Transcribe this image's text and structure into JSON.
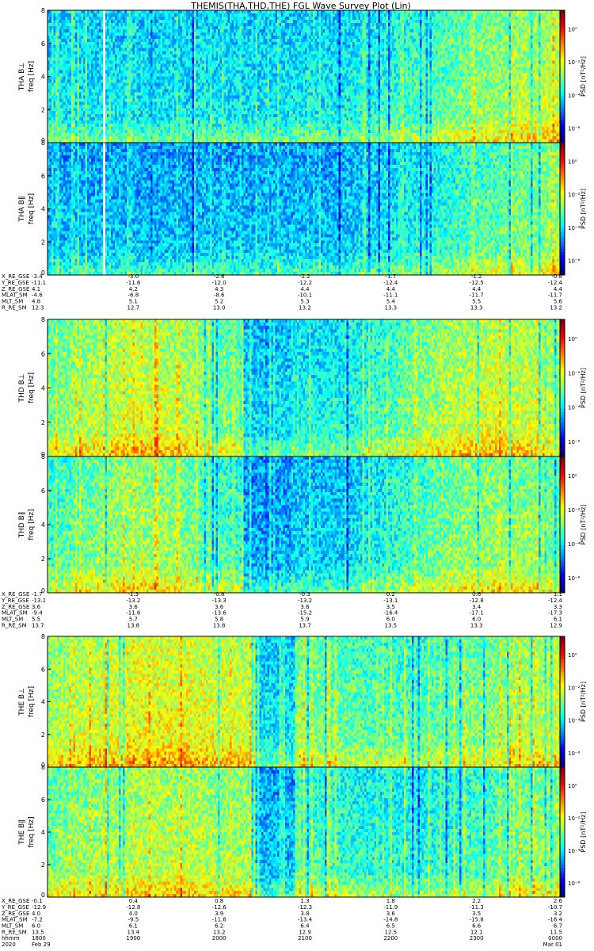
{
  "title": "THEMIS(THA,THD,THE) FGL Wave Survey Plot (Lin)",
  "chart_data": {
    "type": "heatmap",
    "x_axis": {
      "label": "hhmm",
      "date_label": "2020",
      "tick_labels": [
        "Feb 29",
        "1800",
        "1900",
        "2000",
        "2100",
        "2200",
        "2300",
        "0000",
        "Mar 01"
      ]
    },
    "colorbar": {
      "label": "PSD [nT²/Hz]",
      "scale": "log",
      "tick_labels": [
        "10⁰",
        "10⁻²",
        "10⁻⁴",
        "10⁻⁶"
      ]
    },
    "y_axis_range": [
      0,
      8
    ],
    "y_tick_labels": [
      "0",
      "2",
      "4",
      "6",
      "8"
    ],
    "probes": [
      {
        "probe": "THA",
        "panels": [
          {
            "label": "THA B⊥",
            "ylabel": "freq [Hz]"
          },
          {
            "label": "THA B∥",
            "ylabel": "freq [Hz]"
          }
        ],
        "ephemeris": [
          {
            "name": "X_RE_GSE",
            "values": [
              "-3.4",
              "-3.0",
              "-2.6",
              "-2.2",
              "-1.7",
              "-1.2",
              "-0.8"
            ]
          },
          {
            "name": "Y_RE_GSE",
            "values": [
              "-11.1",
              "-11.6",
              "-12.0",
              "-12.2",
              "-12.4",
              "-12.5",
              "-12.4"
            ]
          },
          {
            "name": "Z_RE_GSE",
            "values": [
              "4.1",
              "4.2",
              "4.3",
              "4.4",
              "4.4",
              "4.4",
              "4.4"
            ]
          },
          {
            "name": "MLAT_SM",
            "values": [
              "-4.6",
              "-6.8",
              "-8.6",
              "-10.1",
              "-11.1",
              "-11.7",
              "-11.7"
            ]
          },
          {
            "name": "MLT_SM",
            "values": [
              "4.8",
              "5.1",
              "5.2",
              "5.3",
              "5.4",
              "5.5",
              "5.6"
            ]
          },
          {
            "name": "R_RE_SM",
            "values": [
              "12.3",
              "12.7",
              "13.0",
              "13.2",
              "13.3",
              "13.3",
              "13.2"
            ]
          }
        ]
      },
      {
        "probe": "THD",
        "panels": [
          {
            "label": "THD B⊥",
            "ylabel": "freq [Hz]"
          },
          {
            "label": "THD B∥",
            "ylabel": "freq [Hz]"
          }
        ],
        "ephemeris": [
          {
            "name": "X_RE_GSE",
            "values": [
              "-1.7",
              "-1.3",
              "-0.8",
              "-0.3",
              "0.2",
              "0.6",
              "1.1"
            ]
          },
          {
            "name": "Y_RE_GSE",
            "values": [
              "-13.1",
              "-13.2",
              "-13.3",
              "-13.2",
              "-13.1",
              "-12.8",
              "-12.4"
            ]
          },
          {
            "name": "Z_RE_GSE",
            "values": [
              "3.6",
              "3.6",
              "3.6",
              "3.6",
              "3.5",
              "3.4",
              "3.3"
            ]
          },
          {
            "name": "MLAT_SM",
            "values": [
              "-9.4",
              "-11.6",
              "-13.6",
              "-15.2",
              "-16.4",
              "-17.1",
              "-17.3"
            ]
          },
          {
            "name": "MLT_SM",
            "values": [
              "5.5",
              "5.7",
              "5.8",
              "5.9",
              "6.0",
              "6.0",
              "6.1"
            ]
          },
          {
            "name": "R_RE_SM",
            "values": [
              "13.7",
              "13.8",
              "13.8",
              "13.7",
              "13.5",
              "13.3",
              "12.9"
            ]
          }
        ]
      },
      {
        "probe": "THE",
        "panels": [
          {
            "label": "THE B⊥",
            "ylabel": "freq [Hz]"
          },
          {
            "label": "THE B∥",
            "ylabel": "freq [Hz]"
          }
        ],
        "ephemeris": [
          {
            "name": "X_RE_GSE",
            "values": [
              "-0.1",
              "0.4",
              "0.8",
              "1.3",
              "1.8",
              "2.2",
              "2.6"
            ]
          },
          {
            "name": "Y_RE_GSE",
            "values": [
              "-12.9",
              "-12.8",
              "-12.6",
              "-12.3",
              "-11.9",
              "-11.3",
              "-10.7"
            ]
          },
          {
            "name": "Z_RE_GSE",
            "values": [
              "4.0",
              "4.0",
              "3.9",
              "3.8",
              "3.6",
              "3.5",
              "3.2"
            ]
          },
          {
            "name": "MLAT_SM",
            "values": [
              "-7.2",
              "-9.5",
              "-11.6",
              "-13.4",
              "-14.8",
              "-15.8",
              "-16.4"
            ]
          },
          {
            "name": "MLT_SM",
            "values": [
              "6.0",
              "6.1",
              "6.2",
              "6.4",
              "6.5",
              "6.6",
              "6.7"
            ]
          },
          {
            "name": "R_RE_SM",
            "values": [
              "13.5",
              "13.4",
              "13.2",
              "12.9",
              "12.5",
              "12.1",
              "11.5"
            ]
          }
        ]
      }
    ]
  }
}
